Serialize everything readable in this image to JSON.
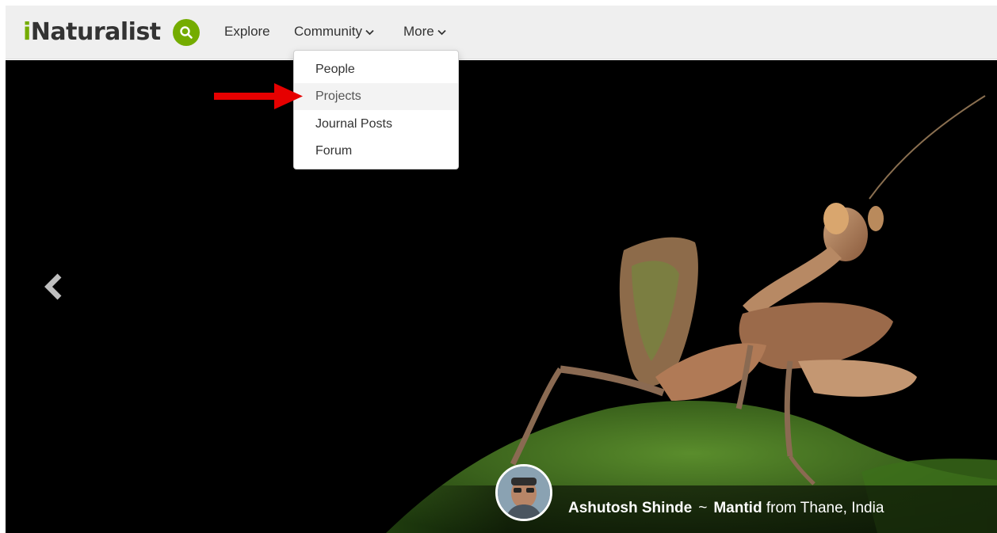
{
  "header": {
    "logo_i": "i",
    "logo_rest": "Naturalist",
    "nav": {
      "explore": "Explore",
      "community": "Community",
      "more": "More"
    }
  },
  "community_menu": {
    "items": [
      {
        "label": "People"
      },
      {
        "label": "Projects"
      },
      {
        "label": "Journal Posts"
      },
      {
        "label": "Forum"
      }
    ],
    "highlighted": "Projects"
  },
  "hero": {
    "photographer": "Ashutosh Shinde",
    "separator": "~",
    "taxon": "Mantid",
    "location_text": "from Thane, India"
  },
  "colors": {
    "brand_green": "#74ac00",
    "annotation_arrow": "#e60000"
  },
  "icons": [
    "search-icon",
    "chevron-down-icon",
    "chevron-left-icon",
    "red-annotation-arrow"
  ]
}
